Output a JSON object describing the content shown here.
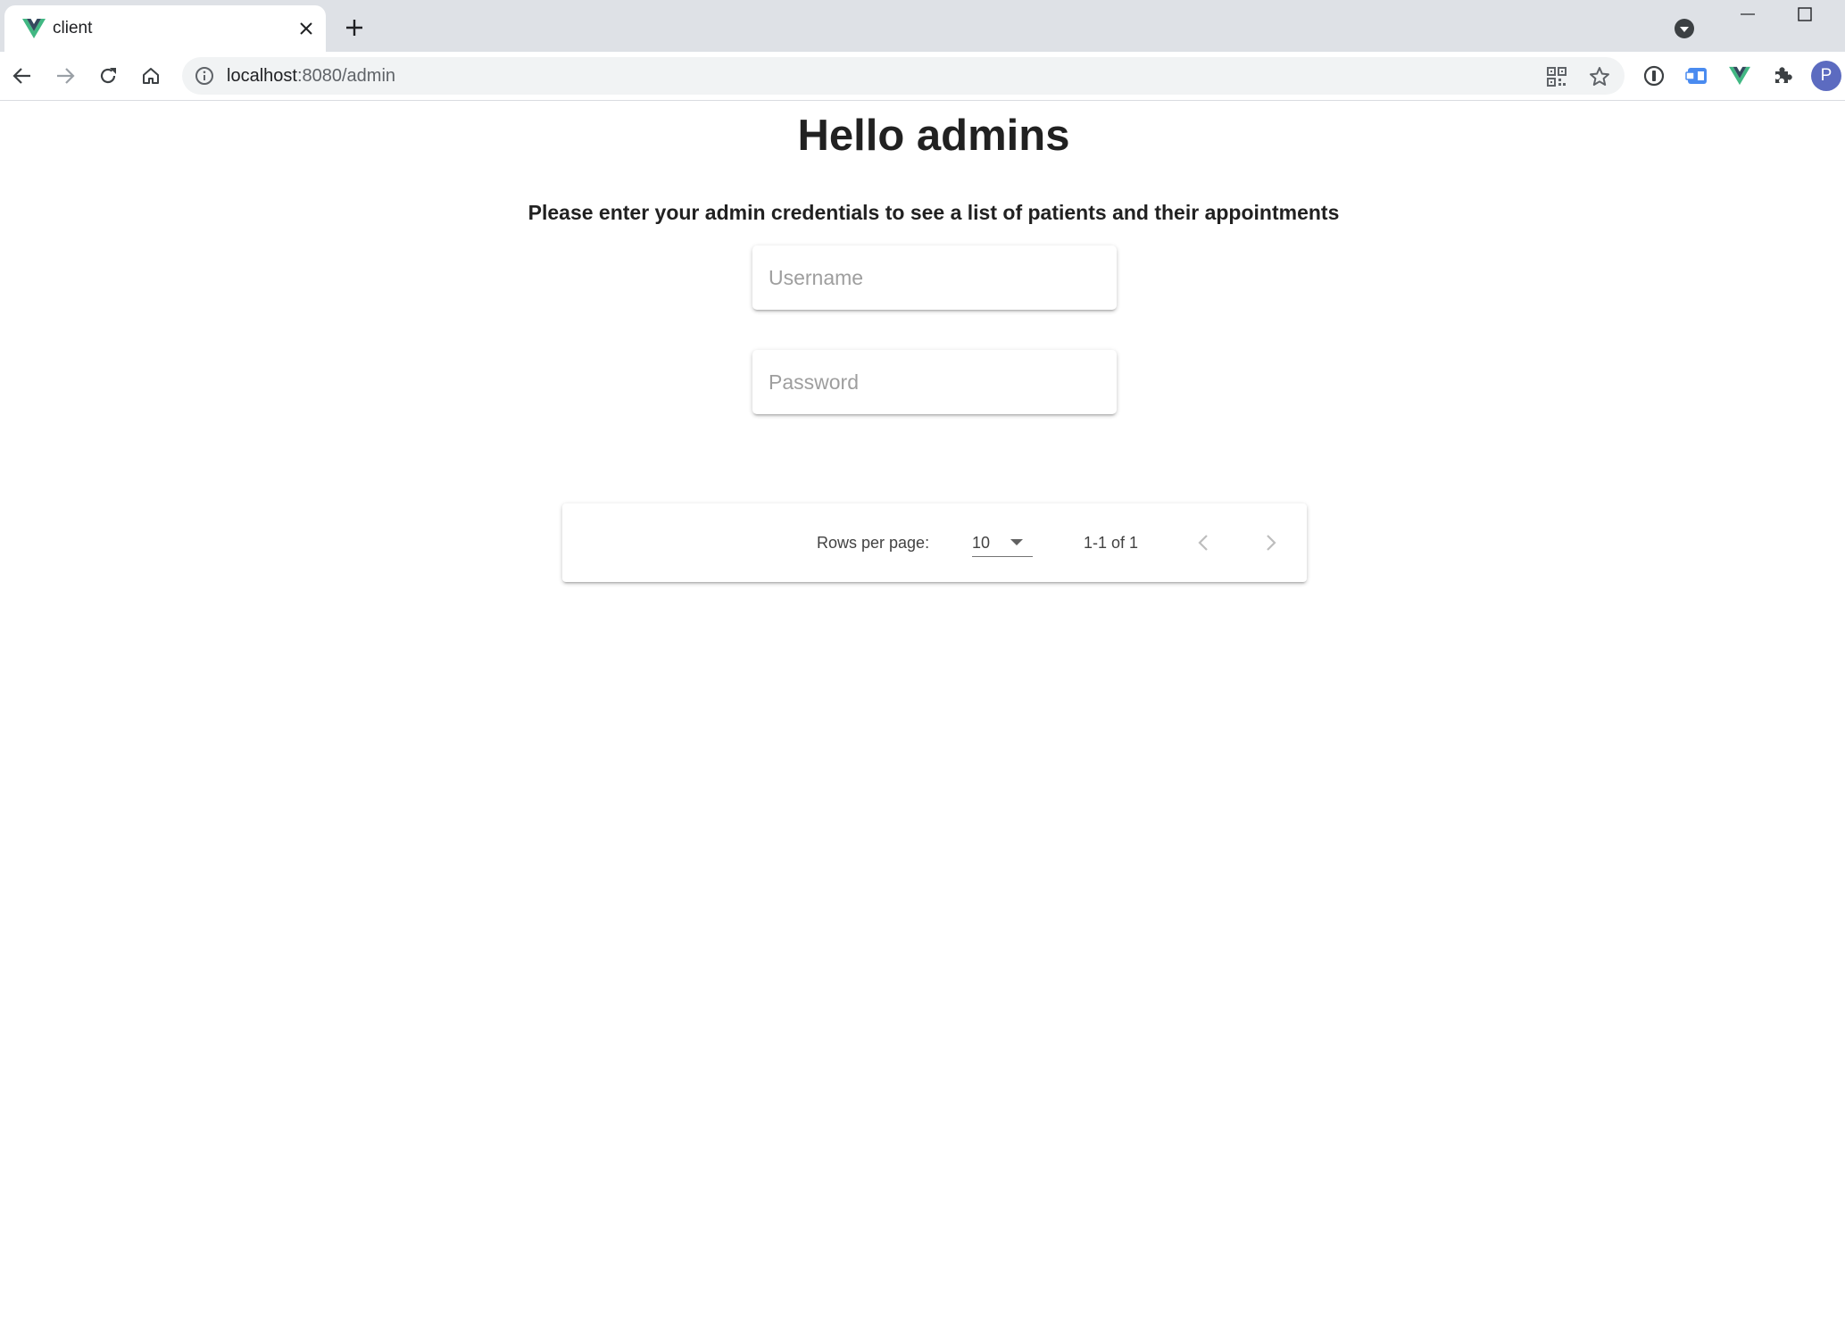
{
  "browser": {
    "tab": {
      "title": "client",
      "favicon": "vue-logo-icon"
    },
    "address_bar": {
      "host": "localhost",
      "path": ":8080/admin"
    },
    "profile_initial": "P"
  },
  "page": {
    "heading": "Hello admins",
    "instructions": "Please enter your admin credentials to see a list of patients and their appointments",
    "username": {
      "placeholder": "Username",
      "value": ""
    },
    "password": {
      "placeholder": "Password",
      "value": ""
    },
    "table_footer": {
      "rows_per_page_label": "Rows per page:",
      "rows_per_page_value": "10",
      "range": "1-1 of 1"
    }
  },
  "colors": {
    "vue_green": "#41b883",
    "vue_dark": "#34495e",
    "avatar": "#5c6bc0"
  }
}
